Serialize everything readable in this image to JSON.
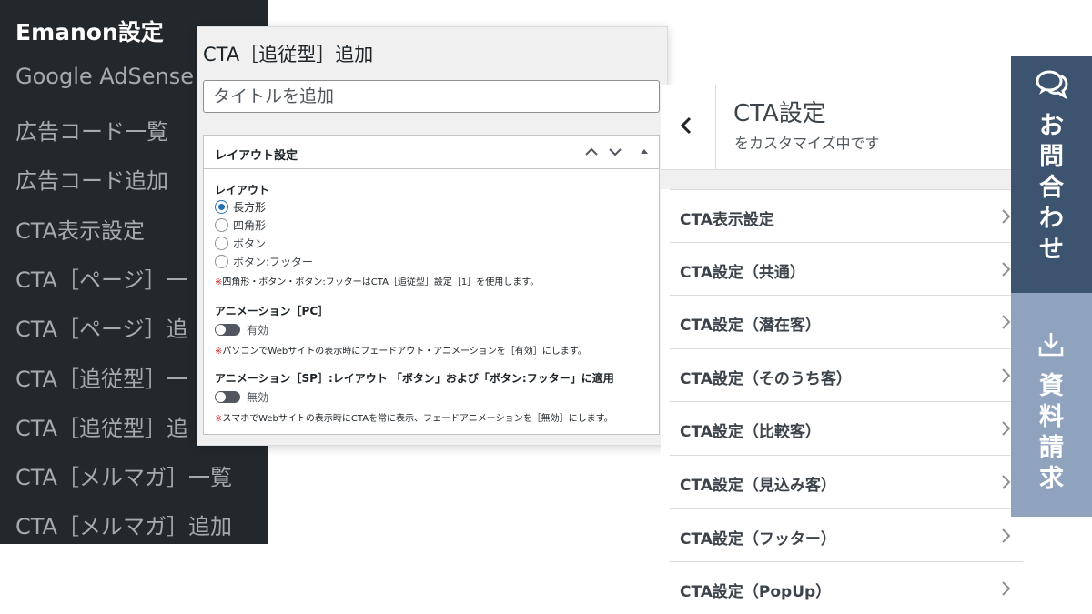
{
  "admin_menu": {
    "title": "Emanon設定",
    "items": [
      "Google AdSense",
      "広告コード一覧",
      "広告コード追加",
      "CTA表示設定",
      "CTA［ページ］一",
      "CTA［ページ］追",
      "CTA［追従型］一",
      "CTA［追従型］追",
      "CTA［メルマガ］一覧",
      "CTA［メルマガ］追加"
    ]
  },
  "editor": {
    "title": "CTA［追従型］追加",
    "title_placeholder": "タイトルを追加",
    "metabox": {
      "title": "レイアウト設定",
      "layout_label": "レイアウト",
      "layout_options": [
        "長方形",
        "四角形",
        "ボタン",
        "ボタン:フッター"
      ],
      "layout_selected": "長方形",
      "layout_note_mark": "※",
      "layout_note": "四角形・ボタン・ボタン:フッターはCTA［追従型］設定［1］を使用します。",
      "animation_pc_label": "アニメーション［PC］",
      "animation_pc_state": "有効",
      "animation_pc_note": "パソコンでWebサイトの表示時にフェードアウト・アニメーションを［有効］にします。",
      "animation_sp_label": "アニメーション［SP］:レイアウト 「ボタン」および「ボタン:フッター」に適用",
      "animation_sp_state": "無効",
      "animation_sp_note": "スマホでWebサイトの表示時にCTAを常に表示、フェードアニメーションを［無効］にします。"
    }
  },
  "customizer": {
    "title": "CTA設定",
    "subtitle": "をカスタマイズ中です",
    "items": [
      "CTA表示設定",
      "CTA設定（共通）",
      "CTA設定（潜在客）",
      "CTA設定（そのうち客）",
      "CTA設定（比較客）",
      "CTA設定（見込み客）",
      "CTA設定（フッター）",
      "CTA設定（PopUp）"
    ]
  },
  "side_tabs": {
    "contact": {
      "chars": [
        "お",
        "問",
        "合",
        "わ",
        "せ"
      ],
      "icon": "chat-bubbles-icon",
      "color": "#3d5470"
    },
    "docs": {
      "chars": [
        "資",
        "料",
        "請",
        "求"
      ],
      "icon": "download-icon",
      "color": "#8fa3bf"
    }
  },
  "colors": {
    "admin_menu_bg": "#23282d",
    "accent": "#2271b1"
  }
}
